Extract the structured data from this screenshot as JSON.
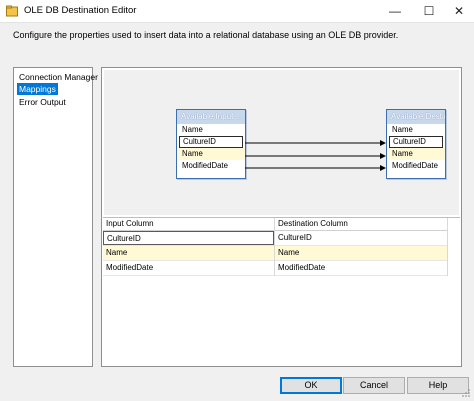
{
  "window": {
    "title": "OLE DB Destination Editor",
    "min_glyph": "—",
    "max_glyph": "☐",
    "close_glyph": "✕"
  },
  "description": "Configure the properties used to insert data into a relational database using an OLE DB provider.",
  "nav": {
    "items": [
      {
        "label": "Connection Manager",
        "selected": false
      },
      {
        "label": "Mappings",
        "selected": true
      },
      {
        "label": "Error Output",
        "selected": false
      }
    ]
  },
  "diagram": {
    "input_table": {
      "title": "Available Input ...",
      "columns": [
        "Name",
        "CultureID",
        "Name",
        "ModifiedDate"
      ]
    },
    "destination_table": {
      "title": "Available Destin...",
      "columns": [
        "Name",
        "CultureID",
        "Name",
        "ModifiedDate"
      ]
    }
  },
  "grid": {
    "headers": {
      "input": "Input Column",
      "destination": "Destination Column"
    },
    "rows": [
      {
        "input": "CultureID",
        "destination": "CultureID"
      },
      {
        "input": "Name",
        "destination": "Name"
      },
      {
        "input": "ModifiedDate",
        "destination": "ModifiedDate"
      }
    ]
  },
  "buttons": {
    "ok": "OK",
    "cancel": "Cancel",
    "help": "Help"
  },
  "colors": {
    "accent": "#0078d7",
    "table_border": "#3c6fb0",
    "highlight_row": "#fff9d6"
  }
}
